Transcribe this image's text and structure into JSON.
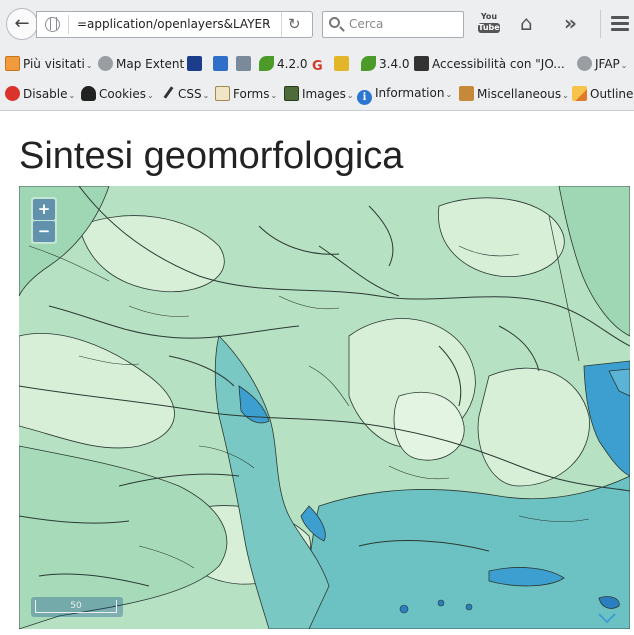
{
  "browser": {
    "url": "=application/openlayers&LAYER",
    "search_placeholder": "Cerca",
    "youtube_label": "You",
    "youtube_tube": "Tube"
  },
  "bookmarks": [
    {
      "label": "Più visitati",
      "icon": "calendar-icon",
      "dropdown": true
    },
    {
      "label": "Map Extent",
      "icon": "globe-icon"
    },
    {
      "label": "",
      "icon": "rai-icon"
    },
    {
      "label": "",
      "icon": "info-square-icon"
    },
    {
      "label": "",
      "icon": "phone-icon"
    },
    {
      "label": "4.2.0",
      "icon": "leaf-icon"
    },
    {
      "label": "",
      "icon": "google-icon"
    },
    {
      "label": "",
      "icon": "pma-icon"
    },
    {
      "label": "3.4.0",
      "icon": "leaf-icon"
    },
    {
      "label": "Accessibilità con \"JO...",
      "icon": "bookmark-icon"
    },
    {
      "label": "JFAP",
      "icon": "globe-icon",
      "dropdown": true
    }
  ],
  "toolbar": [
    {
      "label": "Disable",
      "icon": "disable-icon"
    },
    {
      "label": "Cookies",
      "icon": "cookies-icon"
    },
    {
      "label": "CSS",
      "icon": "css-icon"
    },
    {
      "label": "Forms",
      "icon": "forms-icon"
    },
    {
      "label": "Images",
      "icon": "images-icon"
    },
    {
      "label": "Information",
      "icon": "information-icon"
    },
    {
      "label": "Miscellaneous",
      "icon": "miscellaneous-icon"
    },
    {
      "label": "Outline",
      "icon": "outline-icon"
    }
  ],
  "page": {
    "title": "Sintesi geomorfologica"
  },
  "map": {
    "zoom_in": "+",
    "zoom_out": "−",
    "scale_label": "50",
    "colors": {
      "base": "#b6e1c2",
      "light": "#d9f0d8",
      "mid": "#9fd6b4",
      "teal": "#6cc1c2",
      "blue": "#3d9fd0",
      "deep": "#2a7fc0",
      "line": "#2b3a33"
    }
  }
}
